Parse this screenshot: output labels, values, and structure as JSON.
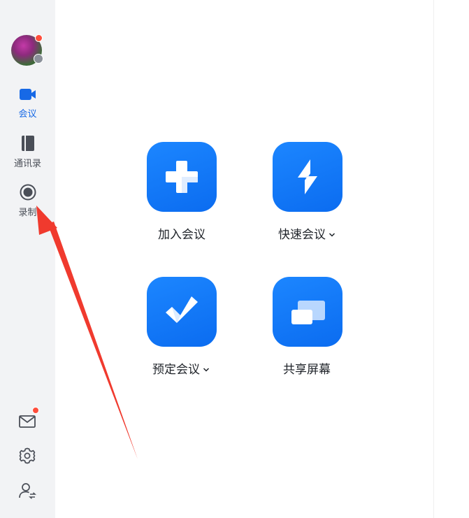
{
  "sidebar": {
    "items": [
      {
        "label": "会议",
        "icon": "video-camera-icon",
        "active": true
      },
      {
        "label": "通讯录",
        "icon": "contacts-book-icon",
        "active": false
      },
      {
        "label": "录制",
        "icon": "record-circle-icon",
        "active": false
      }
    ],
    "bottom": [
      {
        "icon": "mail-icon",
        "has_notification": true
      },
      {
        "icon": "gear-icon"
      },
      {
        "icon": "switch-account-icon"
      }
    ],
    "avatar": {
      "has_notification": true
    }
  },
  "actions": [
    {
      "label": "加入会议",
      "icon": "plus-icon",
      "has_dropdown": false
    },
    {
      "label": "快速会议",
      "icon": "lightning-icon",
      "has_dropdown": true
    },
    {
      "label": "预定会议",
      "icon": "checkmark-icon",
      "has_dropdown": true
    },
    {
      "label": "共享屏幕",
      "icon": "share-screen-icon",
      "has_dropdown": false
    }
  ],
  "colors": {
    "accent": "#1769e6",
    "tile": "#0b6cf0",
    "notification": "#ff4d3b",
    "sidebar_bg": "#f2f3f5",
    "annotation_arrow": "#f03a2e"
  }
}
